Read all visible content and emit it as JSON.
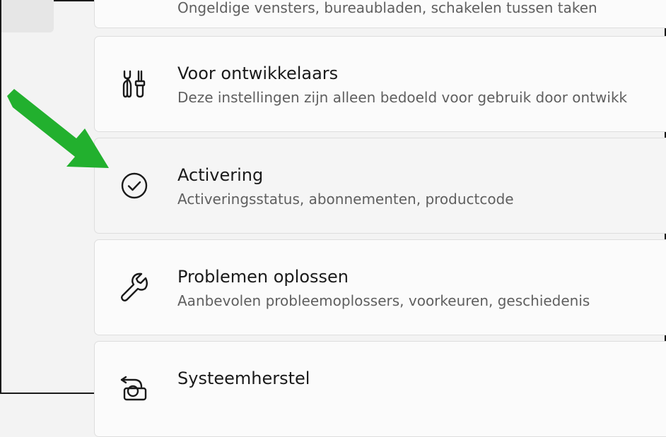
{
  "colors": {
    "page_bg": "#f3f3f3",
    "card_bg": "#fbfbfb",
    "card_hover_bg": "#f5f5f5",
    "card_border": "#dedede",
    "title_text": "#1a1a1a",
    "desc_text": "#5f5f5f",
    "arrow_green": "#22b02e"
  },
  "cards": [
    {
      "title": "",
      "description": "Ongeldige vensters, bureaubladen, schakelen tussen taken"
    },
    {
      "icon": "developer-tools-icon",
      "title": "Voor ontwikkelaars",
      "description": "Deze instellingen zijn alleen bedoeld voor gebruik door ontwikk"
    },
    {
      "icon": "checkmark-circle-icon",
      "title": "Activering",
      "description": "Activeringsstatus, abonnementen, productcode"
    },
    {
      "icon": "wrench-icon",
      "title": "Problemen oplossen",
      "description": "Aanbevolen probleemoplossers, voorkeuren, geschiedenis"
    },
    {
      "icon": "system-restore-icon",
      "title": "Systeemherstel",
      "description": ""
    }
  ],
  "annotation": {
    "icon": "green-arrow-icon"
  }
}
